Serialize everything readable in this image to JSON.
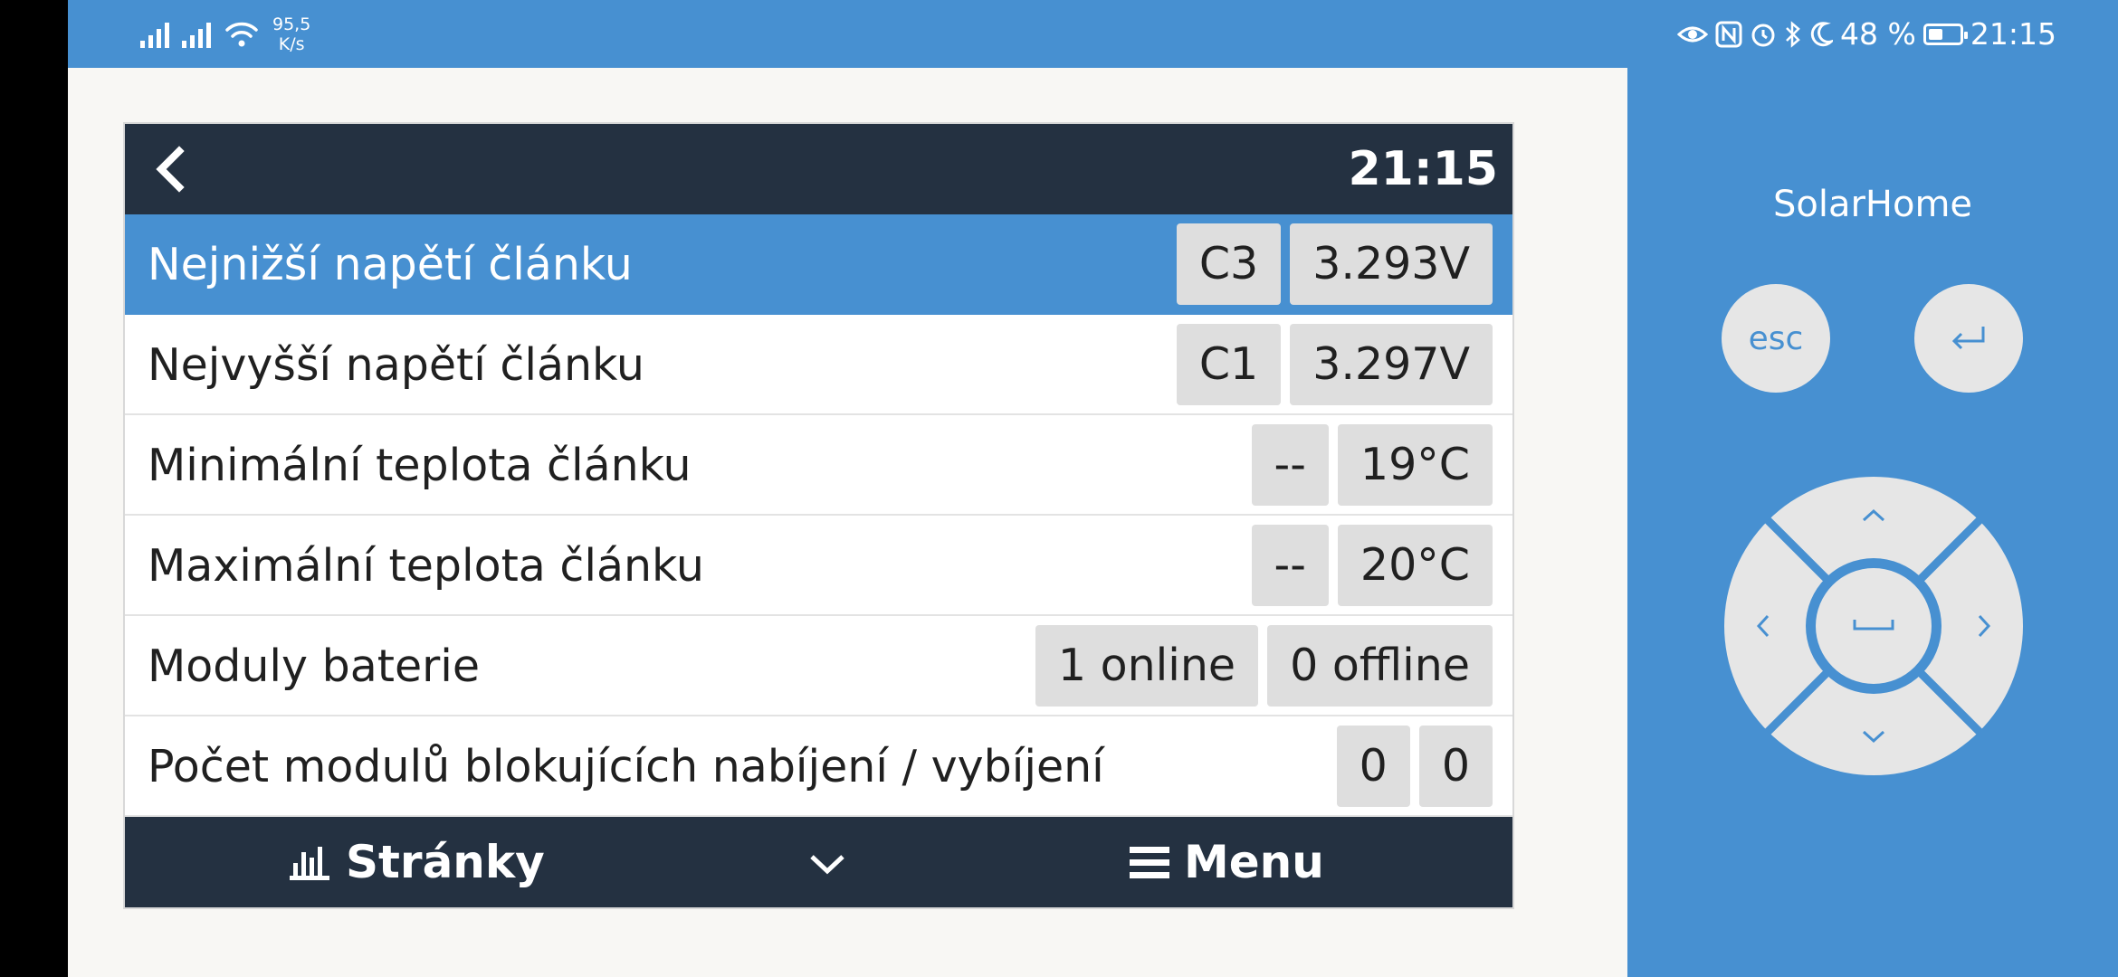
{
  "status_bar": {
    "net_speed_value": "95,5",
    "net_speed_unit": "K/s",
    "battery_percent": "48 %",
    "battery_level": 0.48,
    "time": "21:15",
    "icons": [
      "signal-icon",
      "signal-icon",
      "wifi-icon",
      "eye-icon",
      "nfc-icon",
      "alarm-icon",
      "bluetooth-icon",
      "moon-icon",
      "battery-icon"
    ]
  },
  "device": {
    "header": {
      "time": "21:15"
    },
    "rows": [
      {
        "label": "Nejnižší napětí článku",
        "values": [
          "C3",
          "3.293V"
        ],
        "selected": true
      },
      {
        "label": "Nejvyšší napětí článku",
        "values": [
          "C1",
          "3.297V"
        ]
      },
      {
        "label": "Minimální teplota článku",
        "values": [
          "--",
          "19°C"
        ]
      },
      {
        "label": "Maximální teplota článku",
        "values": [
          "--",
          "20°C"
        ]
      },
      {
        "label": "Moduly baterie",
        "values": [
          "1 online",
          "0 offline"
        ]
      },
      {
        "label": "Počet modulů blokujících nabíjení / vybíjení",
        "values": [
          "0",
          "0"
        ]
      }
    ],
    "footer": {
      "pages_label": "Stránky",
      "menu_label": "Menu"
    }
  },
  "side_panel": {
    "brand": "SolarHome",
    "esc_label": "esc"
  },
  "colors": {
    "accent": "#4790d1",
    "header_bg": "#243141",
    "value_bg": "#dedede",
    "page_bg": "#f8f7f4"
  }
}
